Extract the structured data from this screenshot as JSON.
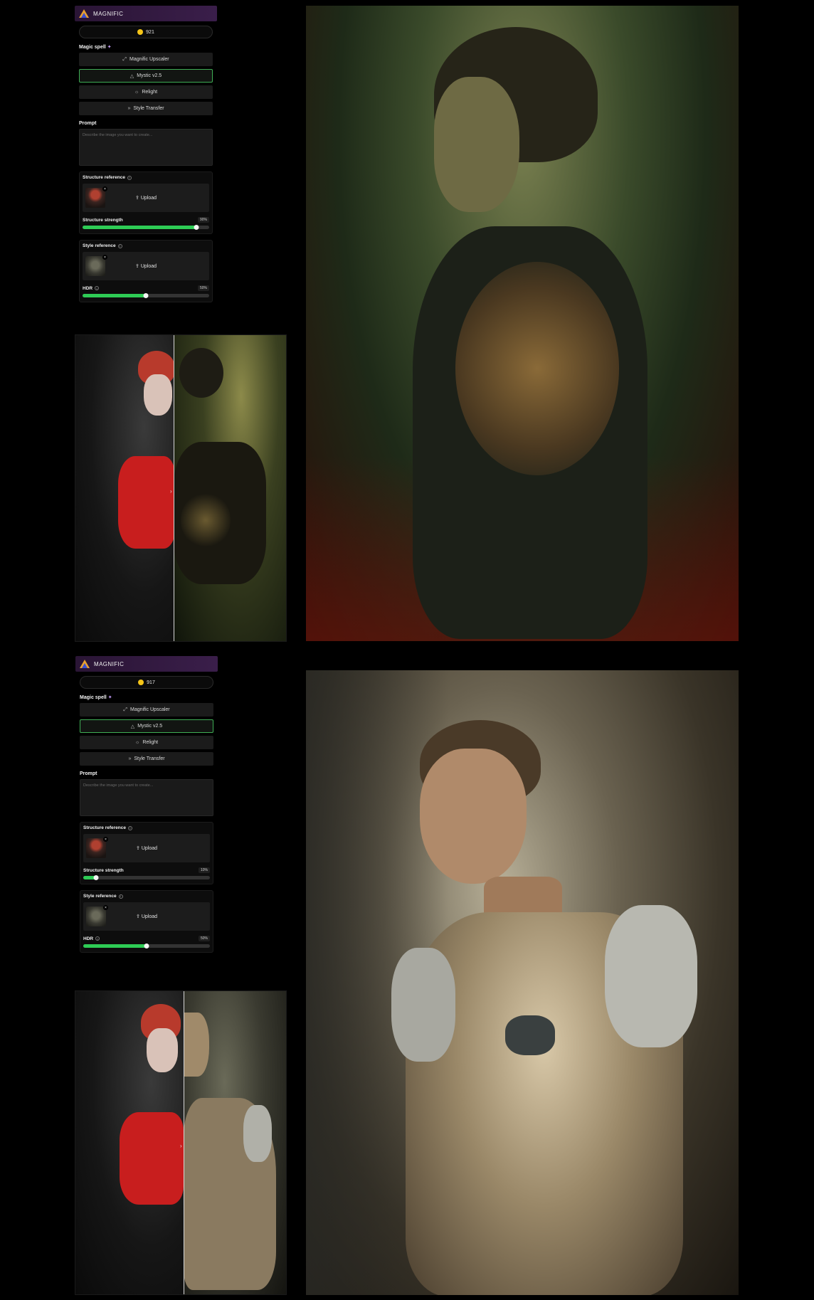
{
  "panels": [
    {
      "brand": "MAGNIFIC",
      "credits": "921",
      "magic_spell_label": "Magic spell",
      "spells": [
        {
          "label": "Magnific Upscaler",
          "icon": "upscale-icon",
          "active": false
        },
        {
          "label": "Mystic v2.5",
          "icon": "triangle-icon",
          "active": true
        },
        {
          "label": "Relight",
          "icon": "sun-icon",
          "active": false
        },
        {
          "label": "Style Transfer",
          "icon": "double-chevron-icon",
          "active": false
        }
      ],
      "prompt_label": "Prompt",
      "prompt_placeholder": "Describe the image you want to create...",
      "structure_reference_label": "Structure reference",
      "structure_upload_label": "Upload",
      "structure_strength_label": "Structure strength",
      "structure_strength_value": "90%",
      "structure_strength_fraction": 0.9,
      "style_reference_label": "Style reference",
      "style_upload_label": "Upload",
      "hdr_label": "HDR",
      "hdr_value": "50%",
      "hdr_fraction": 0.5
    },
    {
      "brand": "MAGNIFIC",
      "credits": "917",
      "magic_spell_label": "Magic spell",
      "spells": [
        {
          "label": "Magnific Upscaler",
          "icon": "upscale-icon",
          "active": false
        },
        {
          "label": "Mystic v2.5",
          "icon": "triangle-icon",
          "active": true
        },
        {
          "label": "Relight",
          "icon": "sun-icon",
          "active": false
        },
        {
          "label": "Style Transfer",
          "icon": "double-chevron-icon",
          "active": false
        }
      ],
      "prompt_label": "Prompt",
      "prompt_placeholder": "Describe the image you want to create...",
      "structure_reference_label": "Structure reference",
      "structure_upload_label": "Upload",
      "structure_strength_label": "Structure strength",
      "structure_strength_value": "10%",
      "structure_strength_fraction": 0.1,
      "style_reference_label": "Style reference",
      "style_upload_label": "Upload",
      "hdr_label": "HDR",
      "hdr_value": "50%",
      "hdr_fraction": 0.5
    }
  ],
  "colors": {
    "accent_green": "#2ecc55",
    "active_border": "#3fae55",
    "header_purple": "#3a1e4a",
    "coin_yellow": "#f5c518"
  }
}
